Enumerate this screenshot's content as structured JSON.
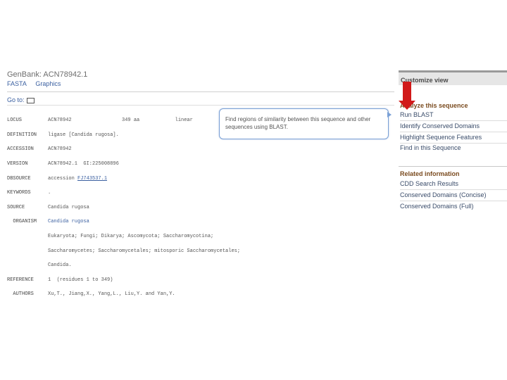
{
  "header": {
    "title": "GenBank: ACN78942.1",
    "links": [
      "FASTA",
      "Graphics"
    ],
    "goto": "Go to:"
  },
  "record": {
    "lines": [
      {
        "label": "LOCUS",
        "text": "ACN78942                 349 aa            linear"
      },
      {
        "label": "DEFINITION",
        "text": "ligase [Candida rugosa]."
      },
      {
        "label": "ACCESSION",
        "text": "ACN78942"
      },
      {
        "label": "VERSION",
        "text": "ACN78942.1  GI:225008896"
      },
      {
        "label": "DBSOURCE",
        "text": "accession ",
        "link": "FJ743537.1"
      },
      {
        "label": "KEYWORDS",
        "text": "."
      },
      {
        "label": "SOURCE",
        "text": "Candida rugosa"
      },
      {
        "label": "  ORGANISM",
        "text": "Candida rugosa",
        "organism": true
      },
      {
        "label": "",
        "text": "Eukaryota; Fungi; Dikarya; Ascomycota; Saccharomycotina;"
      },
      {
        "label": "",
        "text": "Saccharomycetes; Saccharomycetales; mitosporic Saccharomycetales;"
      },
      {
        "label": "",
        "text": "Candida."
      },
      {
        "label": "REFERENCE",
        "text": "1  (residues 1 to 349)"
      },
      {
        "label": "  AUTHORS",
        "text": "Xu,T., Jiang,X., Yang,L., Liu,Y. and Yan,Y."
      }
    ]
  },
  "sidebar": {
    "customize": "Customize view",
    "analyze_title": "Analyze this sequence",
    "analyze_items": [
      "Run BLAST",
      "Identify Conserved Domains",
      "Highlight Sequence Features",
      "Find in this Sequence"
    ],
    "related_title": "Related information",
    "related_items": [
      "CDD Search Results",
      "Conserved Domains (Concise)",
      "Conserved Domains (Full)"
    ]
  },
  "tooltip": {
    "text": "Find regions of similarity between this sequence and other sequences using BLAST."
  },
  "colors": {
    "link": "#3a5fa0",
    "section_title": "#7a4b1f",
    "arrow": "#d11a1a",
    "tooltip_border": "#7aa0d6"
  }
}
